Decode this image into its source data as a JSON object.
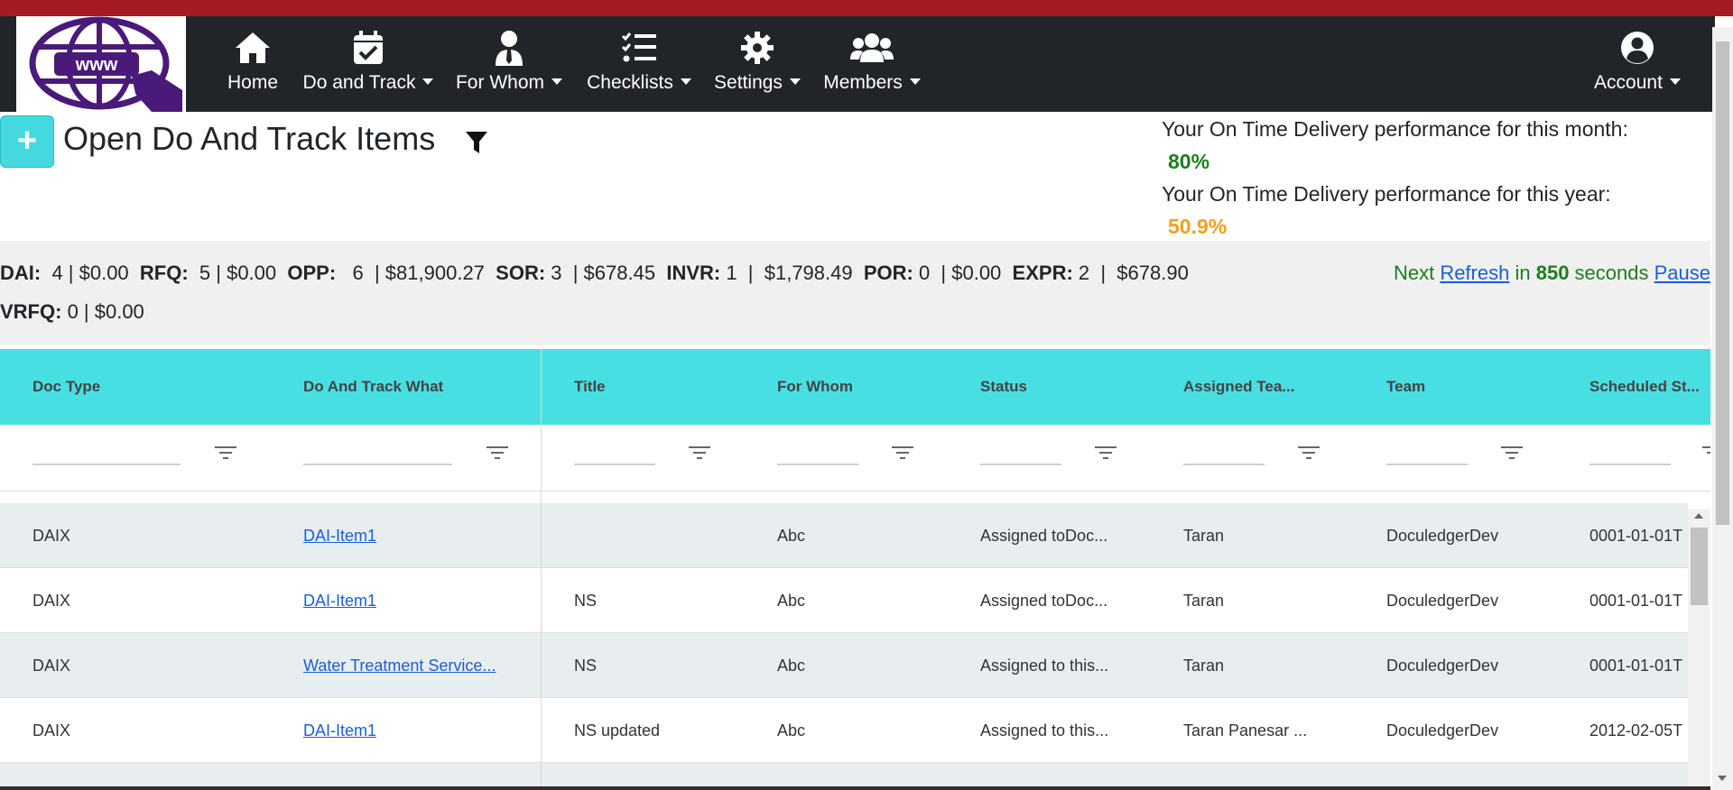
{
  "nav": {
    "items": [
      {
        "label": "Home",
        "icon": "home-icon"
      },
      {
        "label": "Do and Track",
        "icon": "calendar-check-icon"
      },
      {
        "label": "For Whom",
        "icon": "user-tie-icon"
      },
      {
        "label": "Checklists",
        "icon": "tasks-icon"
      },
      {
        "label": "Settings",
        "icon": "gear-icon"
      },
      {
        "label": "Members",
        "icon": "users-icon"
      },
      {
        "label": "Account",
        "icon": "user-circle-icon"
      }
    ],
    "logo_text": "www"
  },
  "page": {
    "title": "Open Do And Track Items",
    "add_label": "+"
  },
  "performance": {
    "month_label": "Your On Time Delivery performance for this month:",
    "month_value": "80%",
    "year_label": "Your On Time Delivery performance for this year:",
    "year_value": "50.9%",
    "month_color": "#1d7d1d",
    "year_color": "#f0a020"
  },
  "summary": {
    "line1": [
      {
        "k": "DAI:",
        "v": "  4 | $0.00 "
      },
      {
        "k": "RFQ:",
        "v": "  5 | $0.00 "
      },
      {
        "k": "OPP:",
        "v": "   6  | $81,900.27 "
      },
      {
        "k": "SOR:",
        "v": " 3  | $678.45 "
      },
      {
        "k": "INVR:",
        "v": " 1  |  $1,798.49 "
      },
      {
        "k": "POR:",
        "v": " 0  | $0.00 "
      },
      {
        "k": "EXPR:",
        "v": " 2  |  $678.90"
      }
    ],
    "line2": [
      {
        "k": "VRFQ:",
        "v": " 0 | $0.00"
      }
    ],
    "refresh": {
      "prefix": "Next ",
      "link": "Refresh",
      "middle": " in ",
      "seconds": "850",
      "suffix": " seconds ",
      "pause": "Pause"
    }
  },
  "grid": {
    "columns": [
      "Doc Type",
      "Do And Track What",
      "Title",
      "For Whom",
      "Status",
      "Assigned Tea...",
      "Team",
      "Scheduled St..."
    ],
    "rows": [
      [
        "DAIX",
        "DAI-Item1",
        "",
        "Abc",
        "Assigned toDoc...",
        "Taran",
        "DoculedgerDev",
        "0001-01-01T"
      ],
      [
        "DAIX",
        "DAI-Item1",
        "NS",
        "Abc",
        "Assigned toDoc...",
        "Taran",
        "DoculedgerDev",
        "0001-01-01T"
      ],
      [
        "DAIX",
        "Water Treatment Service...",
        "NS",
        "Abc",
        "Assigned to this...",
        "Taran",
        "DoculedgerDev",
        "0001-01-01T"
      ],
      [
        "DAIX",
        "DAI-Item1",
        "NS updated",
        "Abc",
        "Assigned to this...",
        "Taran Panesar ...",
        "DoculedgerDev",
        "2012-02-05T"
      ]
    ]
  },
  "colors": {
    "accent": "#48dfe3",
    "navbar": "#212529",
    "topstripe": "#a61b22",
    "logo_purple": "#4a1a7a"
  }
}
